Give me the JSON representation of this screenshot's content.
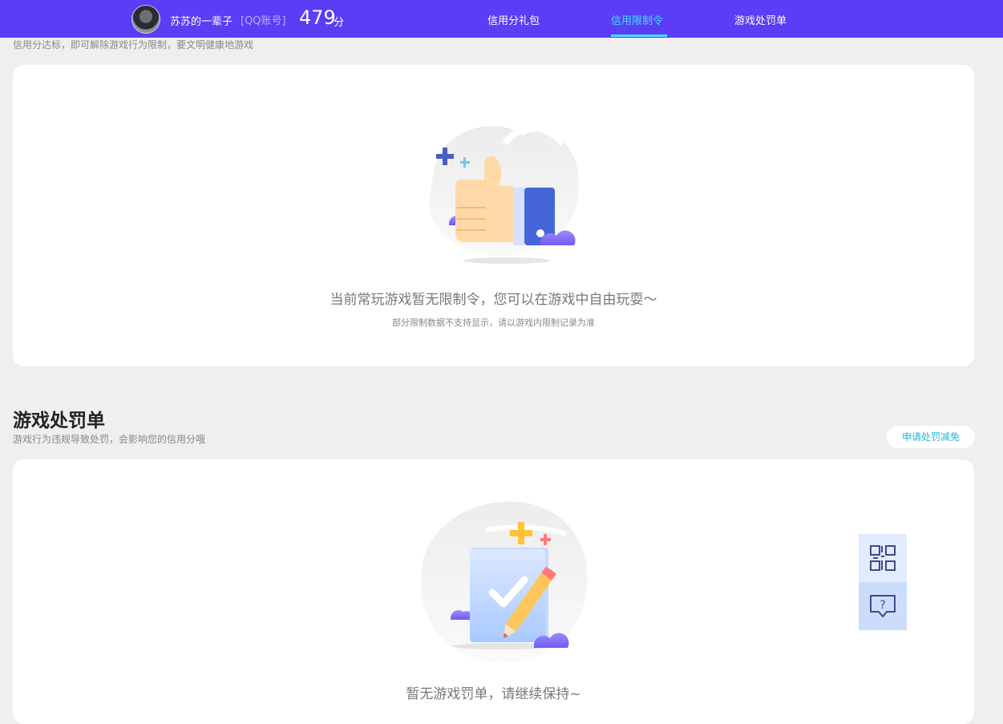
{
  "header": {
    "username": "苏苏的一辈子",
    "account_tag": "[QQ账号]",
    "score": "479",
    "score_unit": "分",
    "nav": [
      {
        "label": "信用分礼包",
        "active": false
      },
      {
        "label": "信用限制令",
        "active": true
      },
      {
        "label": "游戏处罚单",
        "active": false
      }
    ]
  },
  "restriction": {
    "subtitle": "信用分达标，即可解除游戏行为限制，要文明健康地游戏",
    "empty_title": "当前常玩游戏暂无限制令，您可以在游戏中自由玩耍～",
    "empty_sub": "部分限制数据不支持显示，请以游戏内限制记录为准"
  },
  "penalty": {
    "title": "游戏处罚单",
    "subtitle": "游戏行为违规导致处罚，会影响您的信用分哦",
    "apply_button": "申请处罚减免",
    "empty_title": "暂无游戏罚单，请继续保持~"
  },
  "float_bar": {
    "items": [
      {
        "icon": "qrcode-icon"
      },
      {
        "icon": "help-chat-icon"
      }
    ]
  },
  "colors": {
    "header_bg": "#5a3df5",
    "active_nav": "#3ee0ff",
    "page_bg": "#efefef",
    "link_blue": "#25b3e0"
  }
}
